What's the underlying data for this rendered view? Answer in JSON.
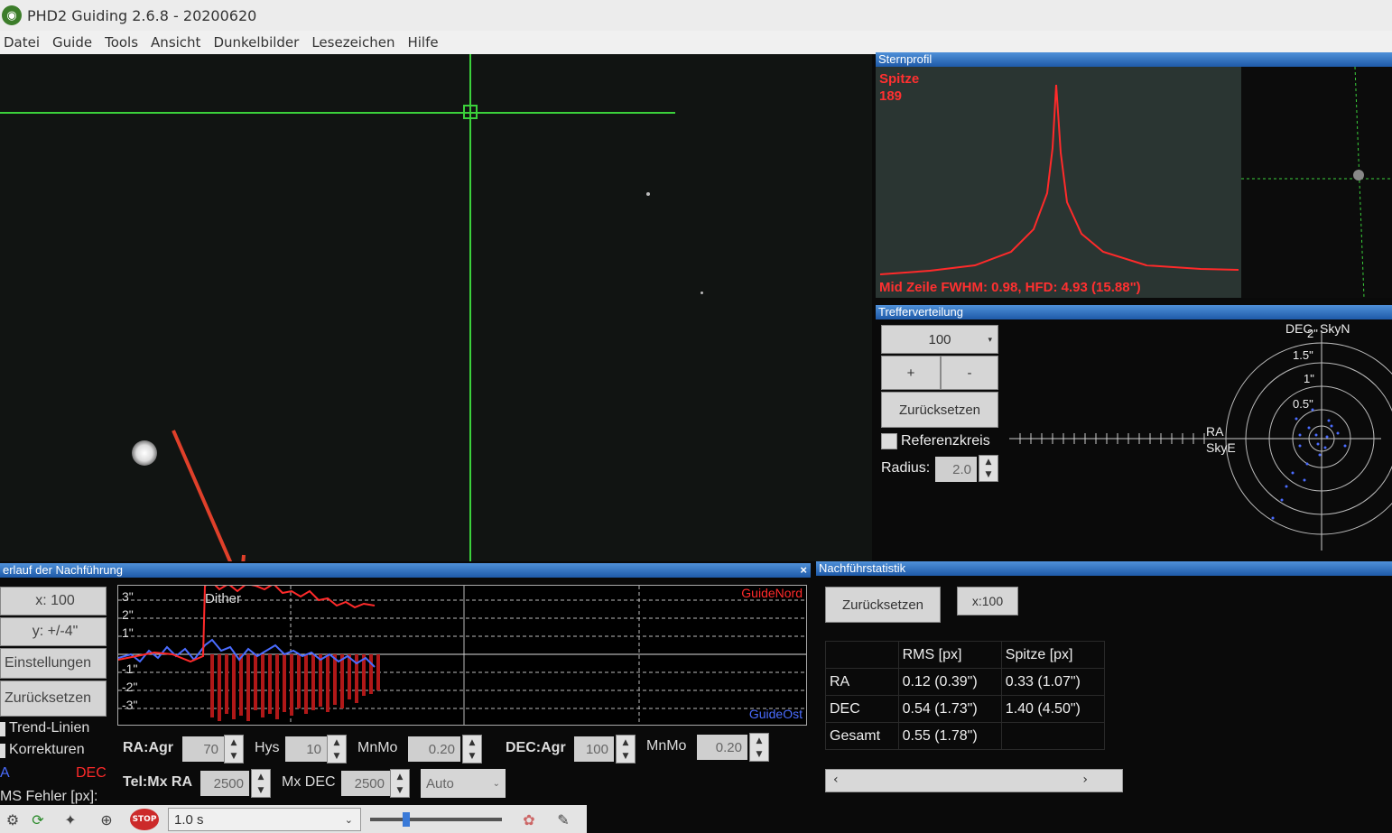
{
  "window": {
    "title": "PHD2 Guiding 2.6.8 - 20200620"
  },
  "menu": [
    "Datei",
    "Guide",
    "Tools",
    "Ansicht",
    "Dunkelbilder",
    "Lesezeichen",
    "Hilfe"
  ],
  "profile": {
    "header": "Sternprofil",
    "peak_label": "Spitze",
    "peak_value": "189",
    "footer": "Mid Zeile FWHM: 0.98, HFD: 4.93 (15.88\")"
  },
  "target": {
    "header": "Trefferverteilung",
    "scale_value": "100",
    "plus": "+",
    "minus": "-",
    "reset": "Zurücksetzen",
    "ref_circle": "Referenzkreis",
    "radius_label": "Radius:",
    "radius_value": "2.0",
    "axis_dec": "DEC",
    "axis_skyn": "SkyN",
    "axis_ra": "RA",
    "axis_skye": "SkyE",
    "rings": [
      "2\"",
      "1.5\"",
      "1\"",
      "0.5\""
    ]
  },
  "history": {
    "header": "erlauf der Nachführung",
    "close": "×",
    "x_scale": "x: 100",
    "y_scale": "y: +/-4\"",
    "settings": "Einstellungen",
    "reset": "Zurücksetzen",
    "trend": "Trend-Linien",
    "corrections": "Korrekturen",
    "ra_legend": "A",
    "dec_legend": "DEC",
    "rms_label": "MS Fehler [px]:",
    "graph_labels": {
      "dither": "Dither",
      "guide_north": "GuideNord",
      "guide_east": "GuideOst",
      "y_ticks": [
        "3\"",
        "2\"",
        "1\"",
        "-1\"",
        "-2\"",
        "-3\""
      ]
    },
    "params": {
      "ra_agr_label": "RA:Agr",
      "ra_agr": "70",
      "hys_label": "Hys",
      "hys": "10",
      "ra_mnmo_label": "MnMo",
      "ra_mnmo": "0.20",
      "dec_agr_label": "DEC:Agr",
      "dec_agr": "100",
      "dec_mnmo_label": "MnMo",
      "dec_mnmo": "0.20",
      "tel_label": "Tel:Mx RA",
      "mx_ra": "2500",
      "mx_dec_label": "Mx DEC",
      "mx_dec": "2500",
      "dec_mode": "Auto"
    }
  },
  "stats": {
    "header": "Nachführstatistik",
    "reset": "Zurücksetzen",
    "x_scale": "x:100",
    "columns": [
      "",
      "RMS [px]",
      "Spitze [px]"
    ],
    "rows": [
      [
        "RA",
        "0.12 (0.39\")",
        "0.33 (1.07\")"
      ],
      [
        "DEC",
        "0.54 (1.73\")",
        "1.40 (4.50\")"
      ],
      [
        "Gesamt",
        "0.55 (1.78\")",
        ""
      ]
    ]
  },
  "toolbar": {
    "exposure": "1.0 s",
    "stop": "STOP"
  },
  "colors": {
    "crosshair": "#3bd13b",
    "ra_trace": "#4a6cff",
    "dec_trace": "#ff2a2a",
    "annotation_arrow": "#e0402a"
  }
}
